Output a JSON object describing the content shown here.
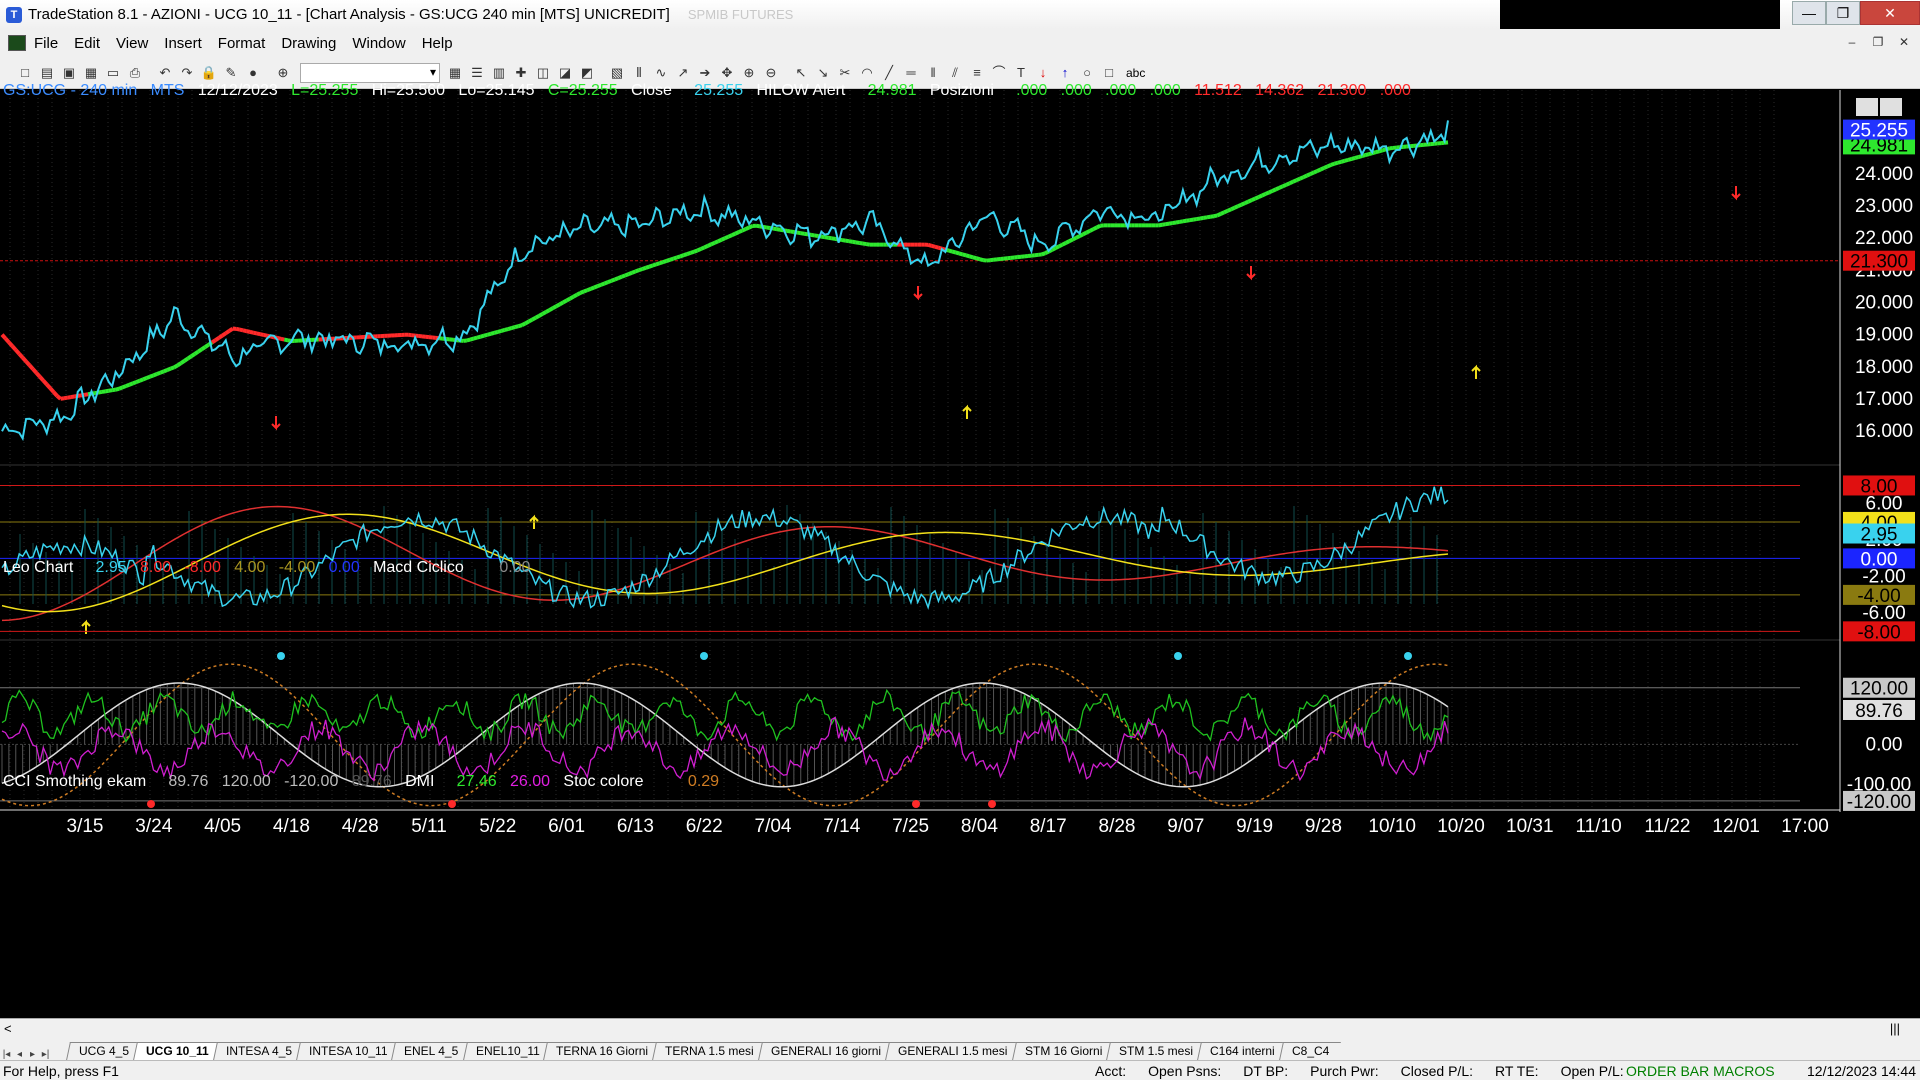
{
  "window": {
    "title": "TradeStation 8.1 - AZIONI - UCG 10_11 - [Chart Analysis - GS:UCG  240 min  [MTS] UNICREDIT]",
    "ghost_text": "SPMIB FUTURES",
    "controls": [
      "—",
      "❐",
      "✕"
    ]
  },
  "menu": [
    "File",
    "Edit",
    "View",
    "Insert",
    "Format",
    "Drawing",
    "Window",
    "Help"
  ],
  "mdi_controls": [
    "–",
    "❐",
    "✕"
  ],
  "toolbar": {
    "icons": [
      "new-icon",
      "open-icon",
      "save-icon",
      "save-all-icon",
      "print-preview-icon",
      "print-icon",
      "undo-icon",
      "redo-icon",
      "lock-icon",
      "paint-icon",
      "color-icon",
      "zoom-icon",
      "grid-icon",
      "list-icon",
      "table-icon",
      "cross-icon",
      "chart-icon",
      "chart2-icon",
      "chart3-icon",
      "format-icon",
      "bars-icon",
      "rsi-icon",
      "trend-icon",
      "arrow-icon",
      "pan-icon",
      "zoom-in-icon",
      "zoom-out-icon",
      "pointer-icon",
      "cursor-icon",
      "tools-icon",
      "gann-icon",
      "line-icon",
      "hline-icon",
      "vline-icon",
      "channel-icon",
      "fib-icon",
      "arc-icon",
      "text-icon",
      "down-arrow-icon",
      "up-arrow-icon",
      "ellipse-icon",
      "rect-icon"
    ],
    "text_tool": "abc"
  },
  "colors": {
    "price": "#39d2ee",
    "red": "#ff2a2a",
    "green": "#2ee82e",
    "yellow": "#f2e01a",
    "macd_red": "#e03030",
    "cci_white": "#dddddd",
    "dmi_green": "#1fc21f",
    "stoc_magenta": "#d01fd0",
    "stoc_orange": "#ce7c23"
  },
  "panel1": {
    "symbol": "GS:UCG - 240 min",
    "mts": "MTS",
    "date": "12/12/2023",
    "last": "L=25.255",
    "high": "Hi=25.560",
    "low": "Lo=25.145",
    "close_eq": "C=25.255",
    "close_label": "Close",
    "close_val": "25.255",
    "hilow_label": "HILOW Alert",
    "hilow_val": "24.981",
    "pos_label": "Posizioni",
    "pos_vals": [
      ".000",
      ".000",
      ".000",
      ".000"
    ],
    "pos_red": [
      "11.512",
      "14.362",
      "21.300",
      ".000"
    ],
    "axis": [
      "24.000",
      "23.000",
      "22.000",
      "21.000",
      "20.000",
      "19.000",
      "18.000",
      "17.000",
      "16.000"
    ],
    "badge_close": "25.255",
    "badge_hilow": "24.981",
    "badge_line": "21.300",
    "line_value": 21.3,
    "ylim": [
      15.1,
      26.3
    ]
  },
  "panel2": {
    "name": "Leo Chart",
    "val": "2.95",
    "levels": [
      "8.00",
      "-8.00",
      "4.00",
      "-4.00",
      "0.00"
    ],
    "macd_label": "Macd Ciclico",
    "macd_val": "0.00",
    "axis": [
      "6.00",
      "2.00",
      "-2.00",
      "-6.00"
    ],
    "badge_8": "8.00",
    "badge_4": "4.00",
    "badge_val": "2.95",
    "badge_0": "0.00",
    "badge_m4": "-4.00",
    "badge_m8": "-8.00",
    "ylim": [
      -8.4,
      8.6
    ]
  },
  "panel3": {
    "name": "CCI Smothing ekam",
    "val": "89.76",
    "lvl_hi": "120.00",
    "lvl_lo": "-120.00",
    "ghost": "89.76",
    "dmi_label": "DMI",
    "dmi1": "27.46",
    "dmi2": "26.00",
    "stoc_label": "Stoc colore",
    "stoc_val": "0.29",
    "axis": [
      "0.00"
    ],
    "badge_hi": "120.00",
    "badge_val": "89.76",
    "badge_lo": "-120.00",
    "badge_lo_ghost": "-100.00",
    "ylim": [
      -135,
      200
    ]
  },
  "x_axis": [
    "3/15",
    "3/24",
    "4/05",
    "4/18",
    "4/28",
    "5/11",
    "5/22",
    "6/01",
    "6/13",
    "6/22",
    "7/04",
    "7/14",
    "7/25",
    "8/04",
    "8/17",
    "8/28",
    "9/07",
    "9/19",
    "9/28",
    "10/10",
    "10/20",
    "10/31",
    "11/10",
    "11/22",
    "12/01",
    "17:00"
  ],
  "chart_data": {
    "type": "line",
    "x": [
      "3/15",
      "3/24",
      "4/05",
      "4/18",
      "4/28",
      "5/11",
      "5/22",
      "6/01",
      "6/13",
      "6/22",
      "7/04",
      "7/14",
      "7/25",
      "8/04",
      "8/17",
      "8/28",
      "9/07",
      "9/19",
      "9/28",
      "10/10",
      "10/20",
      "10/31",
      "11/10",
      "11/22",
      "12/01",
      "12/12"
    ],
    "series": [
      {
        "name": "Close",
        "values": [
          16.0,
          16.4,
          17.8,
          19.6,
          18.3,
          18.9,
          18.8,
          18.7,
          19.0,
          21.7,
          22.3,
          22.4,
          22.9,
          22.5,
          22.1,
          22.5,
          21.1,
          22.7,
          21.8,
          22.9,
          22.6,
          23.9,
          24.5,
          24.9,
          24.8,
          25.255
        ]
      },
      {
        "name": "HILOW Alert",
        "values": [
          19.0,
          17.0,
          17.3,
          18.0,
          19.2,
          18.8,
          18.9,
          19.0,
          18.8,
          19.3,
          20.3,
          21.0,
          21.6,
          22.4,
          22.1,
          21.8,
          21.8,
          21.3,
          21.5,
          22.4,
          22.4,
          22.7,
          23.5,
          24.3,
          24.8,
          24.981
        ]
      }
    ]
  },
  "scroll": {
    "left": "<",
    "right": "|||"
  },
  "tabs": [
    "UCG 4_5",
    "UCG 10_11",
    "INTESA 4_5",
    "INTESA 10_11",
    "ENEL 4_5",
    "ENEL10_11",
    "TERNA 16 Giorni",
    "TERNA 1.5 mesi",
    "GENERALI 16 giorni",
    "GENERALI 1.5 mesi",
    "STM 16 Giorni",
    "STM 1.5 mesi",
    "C164 interni",
    "C8_C4"
  ],
  "tab_nav": [
    "|◂",
    "◂",
    "▸",
    "▸|"
  ],
  "status": {
    "help": "For Help, press F1",
    "fields": [
      "Acct:",
      "Open Psns:",
      "DT BP:",
      "Purch Pwr:",
      "Closed P/L:",
      "RT TE:",
      "Open P/L:"
    ],
    "orderbar": "ORDER BAR  MACROS",
    "datetime": "12/12/2023 14:44"
  }
}
